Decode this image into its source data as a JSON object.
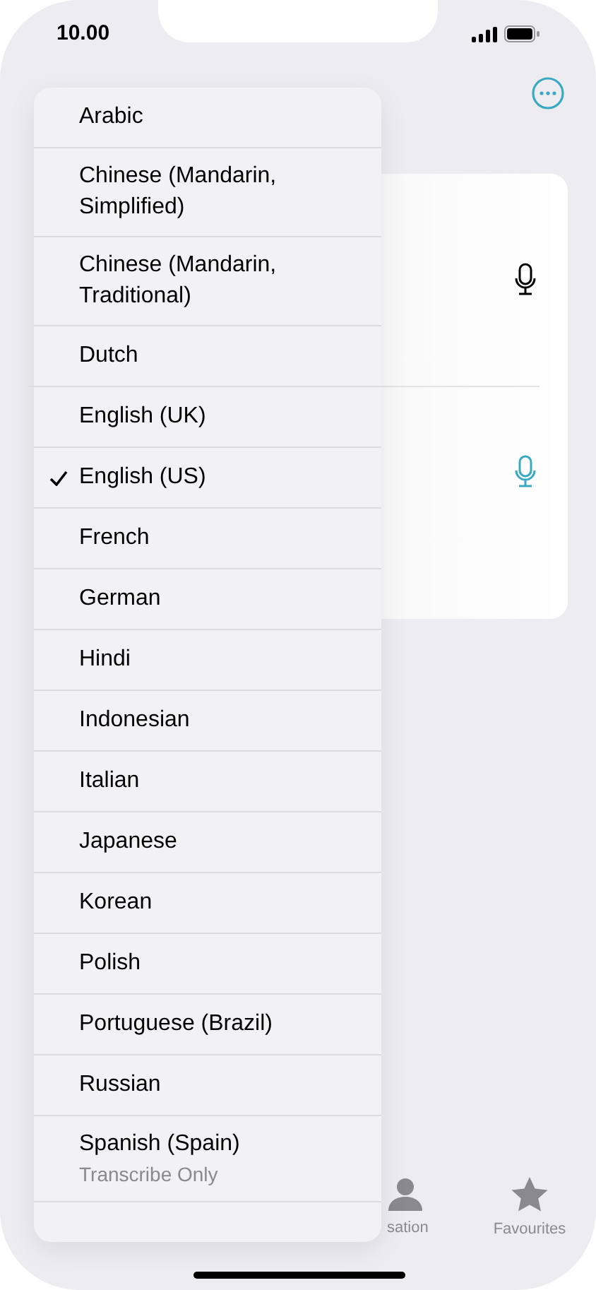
{
  "status_bar": {
    "time": "10.00"
  },
  "menu": {
    "items": [
      {
        "label": "Arabic",
        "checked": false
      },
      {
        "label": "Chinese (Mandarin, Simplified)",
        "checked": false
      },
      {
        "label": "Chinese (Mandarin, Traditional)",
        "checked": false
      },
      {
        "label": "Dutch",
        "checked": false
      },
      {
        "label": "English (UK)",
        "checked": false
      },
      {
        "label": "English (US)",
        "checked": true
      },
      {
        "label": "French",
        "checked": false
      },
      {
        "label": "German",
        "checked": false
      },
      {
        "label": "Hindi",
        "checked": false
      },
      {
        "label": "Indonesian",
        "checked": false
      },
      {
        "label": "Italian",
        "checked": false
      },
      {
        "label": "Japanese",
        "checked": false
      },
      {
        "label": "Korean",
        "checked": false
      },
      {
        "label": "Polish",
        "checked": false
      },
      {
        "label": "Portuguese (Brazil)",
        "checked": false
      },
      {
        "label": "Russian",
        "checked": false
      },
      {
        "label": "Spanish (Spain)",
        "note": "Transcribe Only",
        "checked": false
      }
    ]
  },
  "tab_bar": [
    {
      "label": "sation",
      "selected": false
    },
    {
      "label": "Favourites",
      "selected": false
    }
  ]
}
